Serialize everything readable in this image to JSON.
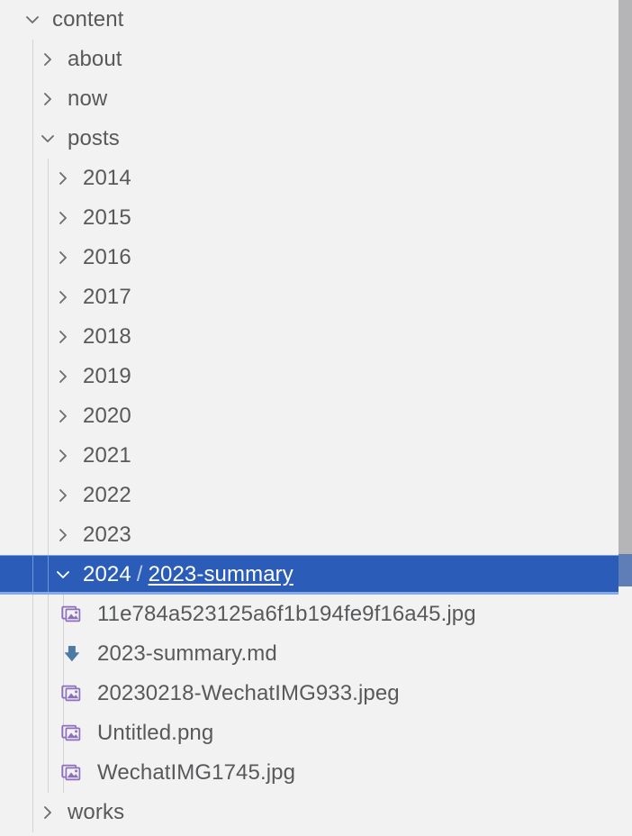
{
  "panel": {
    "name": "file-explorer-tree",
    "background_color": "#f2f2f2",
    "selection_color": "#2a5cb8",
    "text_color": "#58595b",
    "guide_color": "#d3d3d3",
    "image_icon_color": "#8e6fbd",
    "markdown_icon_color": "#4b7aa6"
  },
  "tree": [
    {
      "label": "content",
      "depth": 0,
      "type": "folder",
      "state": "expanded",
      "chevron": "chevron-down-icon",
      "selected": false
    },
    {
      "label": "about",
      "depth": 1,
      "type": "folder",
      "state": "collapsed",
      "chevron": "chevron-right-icon",
      "selected": false
    },
    {
      "label": "now",
      "depth": 1,
      "type": "folder",
      "state": "collapsed",
      "chevron": "chevron-right-icon",
      "selected": false
    },
    {
      "label": "posts",
      "depth": 1,
      "type": "folder",
      "state": "expanded",
      "chevron": "chevron-down-icon",
      "selected": false
    },
    {
      "label": "2014",
      "depth": 2,
      "type": "folder",
      "state": "collapsed",
      "chevron": "chevron-right-icon",
      "selected": false
    },
    {
      "label": "2015",
      "depth": 2,
      "type": "folder",
      "state": "collapsed",
      "chevron": "chevron-right-icon",
      "selected": false
    },
    {
      "label": "2016",
      "depth": 2,
      "type": "folder",
      "state": "collapsed",
      "chevron": "chevron-right-icon",
      "selected": false
    },
    {
      "label": "2017",
      "depth": 2,
      "type": "folder",
      "state": "collapsed",
      "chevron": "chevron-right-icon",
      "selected": false
    },
    {
      "label": "2018",
      "depth": 2,
      "type": "folder",
      "state": "collapsed",
      "chevron": "chevron-right-icon",
      "selected": false
    },
    {
      "label": "2019",
      "depth": 2,
      "type": "folder",
      "state": "collapsed",
      "chevron": "chevron-right-icon",
      "selected": false
    },
    {
      "label": "2020",
      "depth": 2,
      "type": "folder",
      "state": "collapsed",
      "chevron": "chevron-right-icon",
      "selected": false
    },
    {
      "label": "2021",
      "depth": 2,
      "type": "folder",
      "state": "collapsed",
      "chevron": "chevron-right-icon",
      "selected": false
    },
    {
      "label": "2022",
      "depth": 2,
      "type": "folder",
      "state": "collapsed",
      "chevron": "chevron-right-icon",
      "selected": false
    },
    {
      "label": "2023",
      "depth": 2,
      "type": "folder",
      "state": "collapsed",
      "chevron": "chevron-right-icon",
      "selected": false
    },
    {
      "label": "2024",
      "label_separator": "/",
      "label_sub": "2023-summary",
      "depth": 2,
      "type": "folder",
      "state": "expanded",
      "chevron": "chevron-down-icon",
      "selected": true
    },
    {
      "label": "11e784a523125a6f1b194fe9f16a45.jpg",
      "depth": 3,
      "type": "file",
      "icon": "image-file-icon",
      "selected": false
    },
    {
      "label": "2023-summary.md",
      "depth": 3,
      "type": "file",
      "icon": "markdown-file-icon",
      "selected": false
    },
    {
      "label": "20230218-WechatIMG933.jpeg",
      "depth": 3,
      "type": "file",
      "icon": "image-file-icon",
      "selected": false
    },
    {
      "label": "Untitled.png",
      "depth": 3,
      "type": "file",
      "icon": "image-file-icon",
      "selected": false
    },
    {
      "label": "WechatIMG1745.jpg",
      "depth": 3,
      "type": "file",
      "icon": "image-file-icon",
      "selected": false
    },
    {
      "label": "works",
      "depth": 1,
      "type": "folder",
      "state": "collapsed",
      "chevron": "chevron-right-icon",
      "selected": false
    }
  ],
  "scrollbar": {
    "orientation": "vertical",
    "thumb_top": 0,
    "thumb_height": 651
  }
}
